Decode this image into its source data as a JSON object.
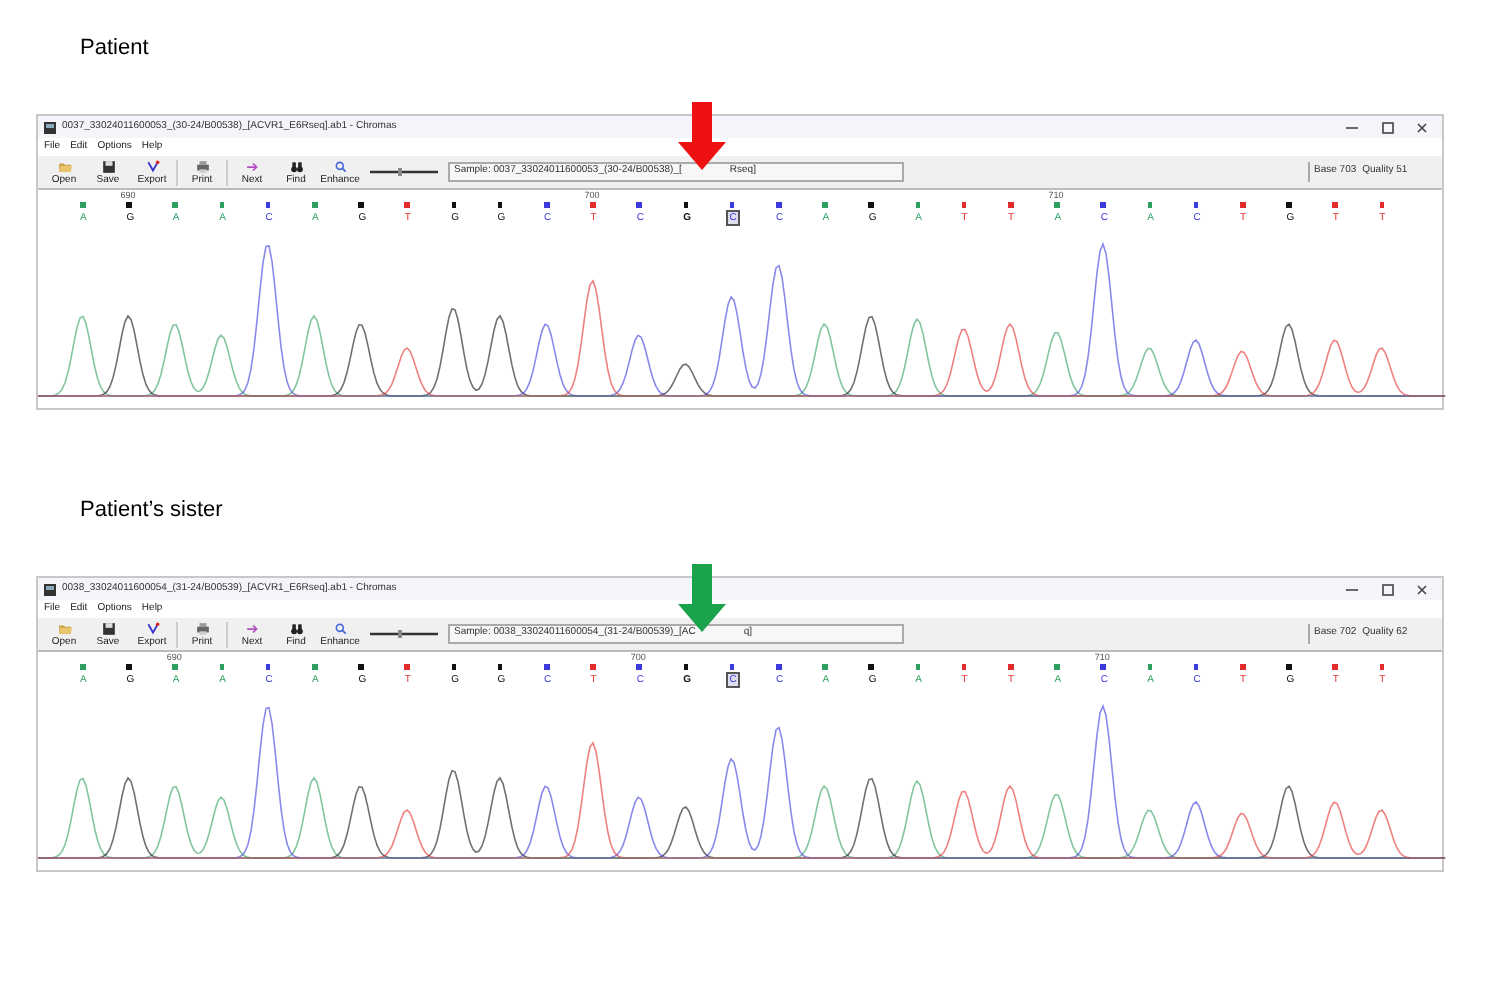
{
  "panels": [
    {
      "label": "Patient",
      "window": {
        "title": "0037_33024011600053_(30-24/B00538)_[ACVR1_E6Rseq].ab1 - Chromas"
      },
      "menu": [
        "File",
        "Edit",
        "Options",
        "Help"
      ],
      "toolbar": [
        "Open",
        "Save",
        "Export",
        "Print",
        "Next",
        "Find",
        "Enhance"
      ],
      "sample": {
        "before": "Sample: 0037_33024011600053_(30-24/B00538)_[",
        "after": "Rseq]"
      },
      "status": [
        "Base 703",
        "Quality 51"
      ],
      "arrow": {
        "color": "#ee1111"
      },
      "bases": [
        {
          "letter": "A",
          "color": "#2e9e5e",
          "selected": false,
          "boxed": false
        },
        {
          "letter": "G",
          "color": "#111111",
          "selected": false,
          "boxed": false,
          "tick": "690"
        },
        {
          "letter": "A",
          "color": "#2e9e5e",
          "selected": false,
          "boxed": false
        },
        {
          "letter": "A",
          "color": "#2e9e5e",
          "selected": false,
          "boxed": false
        },
        {
          "letter": "C",
          "color": "#3b3bdc",
          "selected": false,
          "boxed": false
        },
        {
          "letter": "A",
          "color": "#2e9e5e",
          "selected": false,
          "boxed": false
        },
        {
          "letter": "G",
          "color": "#111111",
          "selected": false,
          "boxed": false
        },
        {
          "letter": "T",
          "color": "#e22b2b",
          "selected": false,
          "boxed": false
        },
        {
          "letter": "G",
          "color": "#111111",
          "selected": false,
          "boxed": false
        },
        {
          "letter": "G",
          "color": "#111111",
          "selected": false,
          "boxed": false
        },
        {
          "letter": "C",
          "color": "#3b3bdc",
          "selected": false,
          "boxed": false
        },
        {
          "letter": "T",
          "color": "#e22b2b",
          "selected": false,
          "boxed": false,
          "tick": "700"
        },
        {
          "letter": "C",
          "color": "#3b3bdc",
          "selected": false,
          "boxed": false
        },
        {
          "letter": "G",
          "color": "#111111",
          "selected": true,
          "boxed": false
        },
        {
          "letter": "C",
          "color": "#3b3bdc",
          "selected": false,
          "boxed": true
        },
        {
          "letter": "C",
          "color": "#3b3bdc",
          "selected": false,
          "boxed": false
        },
        {
          "letter": "A",
          "color": "#2e9e5e",
          "selected": false,
          "boxed": false
        },
        {
          "letter": "G",
          "color": "#111111",
          "selected": false,
          "boxed": false
        },
        {
          "letter": "A",
          "color": "#2e9e5e",
          "selected": false,
          "boxed": false
        },
        {
          "letter": "T",
          "color": "#e22b2b",
          "selected": false,
          "boxed": false
        },
        {
          "letter": "T",
          "color": "#e22b2b",
          "selected": false,
          "boxed": false
        },
        {
          "letter": "A",
          "color": "#2e9e5e",
          "selected": false,
          "boxed": false,
          "tick": "710"
        },
        {
          "letter": "C",
          "color": "#3b3bdc",
          "selected": false,
          "boxed": false
        },
        {
          "letter": "A",
          "color": "#2e9e5e",
          "selected": false,
          "boxed": false
        },
        {
          "letter": "C",
          "color": "#3b3bdc",
          "selected": false,
          "boxed": false
        },
        {
          "letter": "T",
          "color": "#e22b2b",
          "selected": false,
          "boxed": false
        },
        {
          "letter": "G",
          "color": "#111111",
          "selected": false,
          "boxed": false
        },
        {
          "letter": "T",
          "color": "#e22b2b",
          "selected": false,
          "boxed": false
        },
        {
          "letter": "T",
          "color": "#e22b2b",
          "selected": false,
          "boxed": false
        }
      ]
    },
    {
      "label": "Patient’s sister",
      "window": {
        "title": "0038_33024011600054_(31-24/B00539)_[ACVR1_E6Rseq].ab1 - Chromas"
      },
      "menu": [
        "File",
        "Edit",
        "Options",
        "Help"
      ],
      "toolbar": [
        "Open",
        "Save",
        "Export",
        "Print",
        "Next",
        "Find",
        "Enhance"
      ],
      "sample": {
        "before": "Sample: 0038_33024011600054_(31-24/B00539)_[AC",
        "after": "q]"
      },
      "status": [
        "Base 702",
        "Quality 62"
      ],
      "arrow": {
        "color": "#1aa34a"
      },
      "bases": [
        {
          "letter": "A",
          "color": "#2e9e5e",
          "selected": false,
          "boxed": false
        },
        {
          "letter": "G",
          "color": "#111111",
          "selected": false,
          "boxed": false
        },
        {
          "letter": "A",
          "color": "#2e9e5e",
          "selected": false,
          "boxed": false,
          "tick": "690"
        },
        {
          "letter": "A",
          "color": "#2e9e5e",
          "selected": false,
          "boxed": false
        },
        {
          "letter": "C",
          "color": "#3b3bdc",
          "selected": false,
          "boxed": false
        },
        {
          "letter": "A",
          "color": "#2e9e5e",
          "selected": false,
          "boxed": false
        },
        {
          "letter": "G",
          "color": "#111111",
          "selected": false,
          "boxed": false
        },
        {
          "letter": "T",
          "color": "#e22b2b",
          "selected": false,
          "boxed": false
        },
        {
          "letter": "G",
          "color": "#111111",
          "selected": false,
          "boxed": false
        },
        {
          "letter": "G",
          "color": "#111111",
          "selected": false,
          "boxed": false
        },
        {
          "letter": "C",
          "color": "#3b3bdc",
          "selected": false,
          "boxed": false
        },
        {
          "letter": "T",
          "color": "#e22b2b",
          "selected": false,
          "boxed": false
        },
        {
          "letter": "C",
          "color": "#3b3bdc",
          "selected": false,
          "boxed": false,
          "tick": "700"
        },
        {
          "letter": "G",
          "color": "#111111",
          "selected": true,
          "boxed": false
        },
        {
          "letter": "C",
          "color": "#3b3bdc",
          "selected": false,
          "boxed": true
        },
        {
          "letter": "C",
          "color": "#3b3bdc",
          "selected": false,
          "boxed": false
        },
        {
          "letter": "A",
          "color": "#2e9e5e",
          "selected": false,
          "boxed": false
        },
        {
          "letter": "G",
          "color": "#111111",
          "selected": false,
          "boxed": false
        },
        {
          "letter": "A",
          "color": "#2e9e5e",
          "selected": false,
          "boxed": false
        },
        {
          "letter": "T",
          "color": "#e22b2b",
          "selected": false,
          "boxed": false
        },
        {
          "letter": "T",
          "color": "#e22b2b",
          "selected": false,
          "boxed": false
        },
        {
          "letter": "A",
          "color": "#2e9e5e",
          "selected": false,
          "boxed": false
        },
        {
          "letter": "C",
          "color": "#3b3bdc",
          "selected": false,
          "boxed": false,
          "tick": "710"
        },
        {
          "letter": "A",
          "color": "#2e9e5e",
          "selected": false,
          "boxed": false
        },
        {
          "letter": "C",
          "color": "#3b3bdc",
          "selected": false,
          "boxed": false
        },
        {
          "letter": "T",
          "color": "#e22b2b",
          "selected": false,
          "boxed": false
        },
        {
          "letter": "G",
          "color": "#111111",
          "selected": false,
          "boxed": false
        },
        {
          "letter": "T",
          "color": "#e22b2b",
          "selected": false,
          "boxed": false
        },
        {
          "letter": "T",
          "color": "#e22b2b",
          "selected": false,
          "boxed": false
        }
      ]
    }
  ]
}
